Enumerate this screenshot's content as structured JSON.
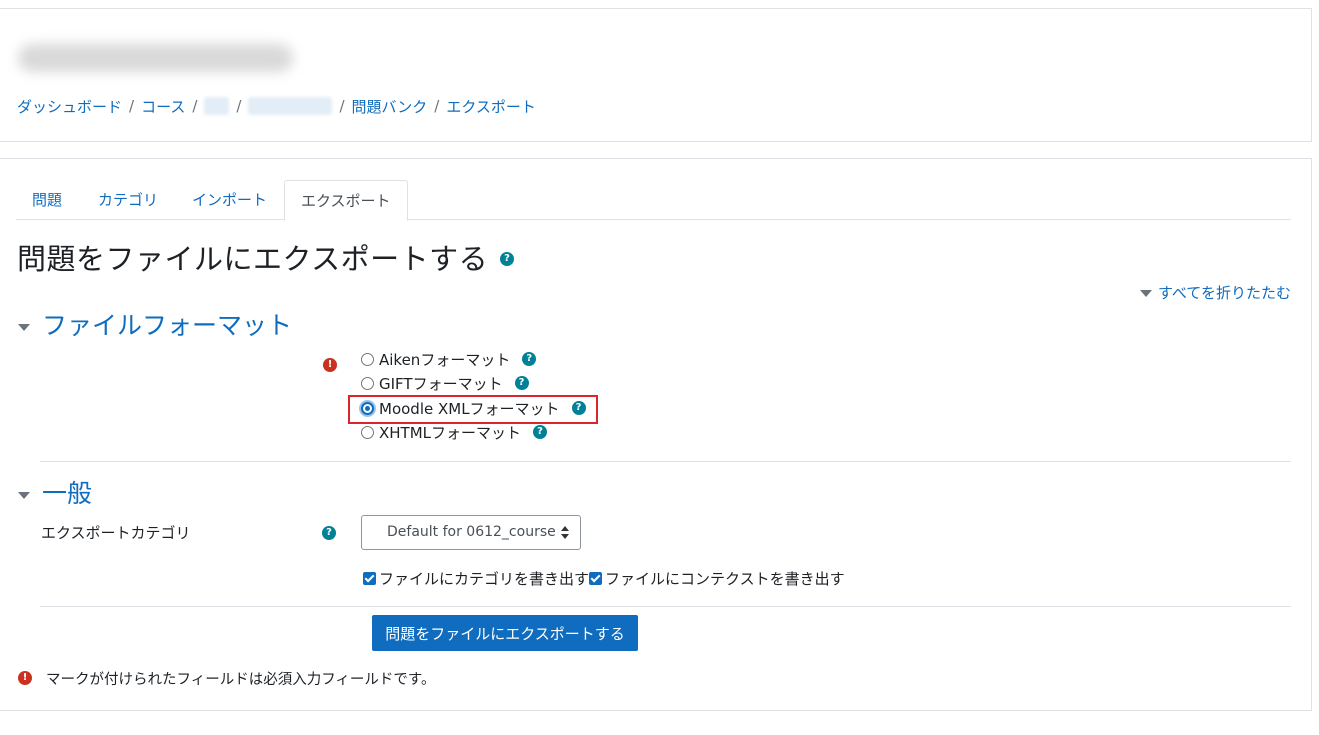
{
  "breadcrumb": {
    "items": [
      "ダッシュボード",
      "コース",
      "問題バンク",
      "エクスポート"
    ],
    "separator": "/"
  },
  "tabs": [
    {
      "label": "問題"
    },
    {
      "label": "カテゴリ"
    },
    {
      "label": "インポート"
    },
    {
      "label": "エクスポート",
      "active": true
    }
  ],
  "page": {
    "title": "問題をファイルにエクスポートする",
    "collapse_all": "すべてを折りたたむ"
  },
  "sections": {
    "file_format": {
      "heading": "ファイルフォーマット",
      "options": [
        {
          "label": "Aikenフォーマット",
          "checked": false
        },
        {
          "label": "GIFTフォーマット",
          "checked": false
        },
        {
          "label": "Moodle XMLフォーマット",
          "checked": true
        },
        {
          "label": "XHTMLフォーマット",
          "checked": false
        }
      ]
    },
    "general": {
      "heading": "一般",
      "category_label": "エクスポートカテゴリ",
      "category_value": "Default for 0612_course",
      "checkbox_category": "ファイルにカテゴリを書き出す",
      "checkbox_context": "ファイルにコンテクストを書き出す"
    }
  },
  "submit_label": "問題をファイルにエクスポートする",
  "required_note": "マークが付けられたフィールドは必須入力フィールドです。",
  "icons": {
    "help": "?",
    "required": "!"
  },
  "colors": {
    "link": "#0f6cbf",
    "help": "#008196",
    "required": "#ca3120",
    "highlight": "#d9262e"
  }
}
